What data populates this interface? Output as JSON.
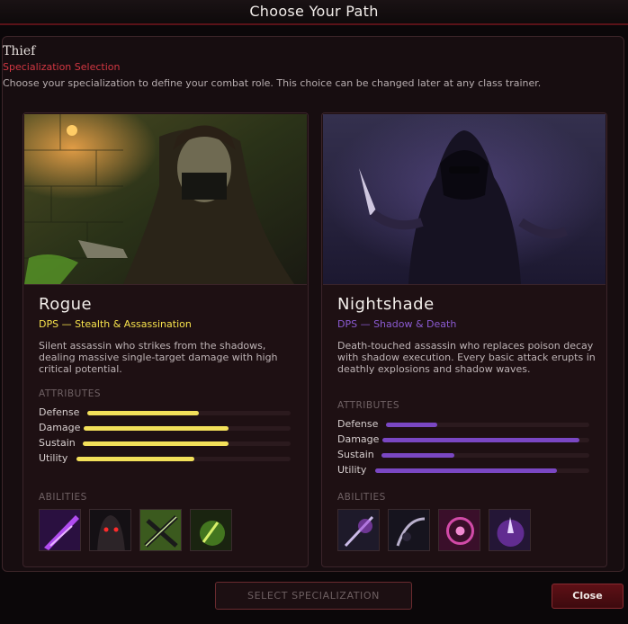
{
  "window": {
    "title": "Choose Your Path"
  },
  "header": {
    "class_name": "Thief",
    "subtitle": "Specialization Selection",
    "description": "Choose your specialization to define your combat role. This choice can be changed later at any class trainer."
  },
  "specs": [
    {
      "name": "Rogue",
      "role": "DPS — Stealth & Assassination",
      "description": "Silent assassin who strikes from the shadows, dealing massive single-target damage with high critical potential.",
      "attributes_heading": "ATTRIBUTES",
      "attributes": [
        {
          "label": "Defense",
          "value": 0.55
        },
        {
          "label": "Damage",
          "value": 0.7
        },
        {
          "label": "Sustain",
          "value": 0.7
        },
        {
          "label": "Utility",
          "value": 0.55
        }
      ],
      "abilities_heading": "ABILITIES",
      "abilities": [
        "purple-slash-ability-icon",
        "hooded-red-eyes-ability-icon",
        "crossed-daggers-ability-icon",
        "green-poison-ability-icon"
      ],
      "accent": "#f3e05a"
    },
    {
      "name": "Nightshade",
      "role": "DPS — Shadow & Death",
      "description": "Death-touched assassin who replaces poison decay with shadow execution. Every basic attack erupts in deathly explosions and shadow  waves.",
      "attributes_heading": "ATTRIBUTES",
      "attributes": [
        {
          "label": "Defense",
          "value": 0.25
        },
        {
          "label": "Damage",
          "value": 0.95
        },
        {
          "label": "Sustain",
          "value": 0.35
        },
        {
          "label": "Utility",
          "value": 0.85
        }
      ],
      "abilities_heading": "ABILITIES",
      "abilities": [
        "shadow-blade-ability-icon",
        "reaper-scythe-ability-icon",
        "death-sigil-ability-icon",
        "shadow-burst-ability-icon"
      ],
      "accent": "#7a47c3"
    }
  ],
  "footer": {
    "select_label": "SELECT SPECIALIZATION",
    "close_label": "Close"
  }
}
